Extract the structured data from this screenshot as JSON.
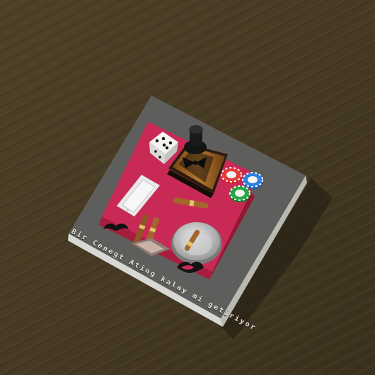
{
  "scene": {
    "description_objects": [
      "table-surface",
      "cake-board",
      "cake",
      "dice",
      "whiskey-bottle",
      "smartphone",
      "poker-chips",
      "cigars",
      "ashtray"
    ]
  },
  "cake_text": "Bir Cenegt Ating kalay mi getiriyor",
  "colors": {
    "table": "#4a3d27",
    "board": "#5c5c5a",
    "cake_top": "#c92a55",
    "cake_side": "#b1213f",
    "bottle": "#9c6222",
    "chip_red": "#d21d2a",
    "chip_blue": "#1e6fd0",
    "chip_green": "#1c9b3a"
  }
}
